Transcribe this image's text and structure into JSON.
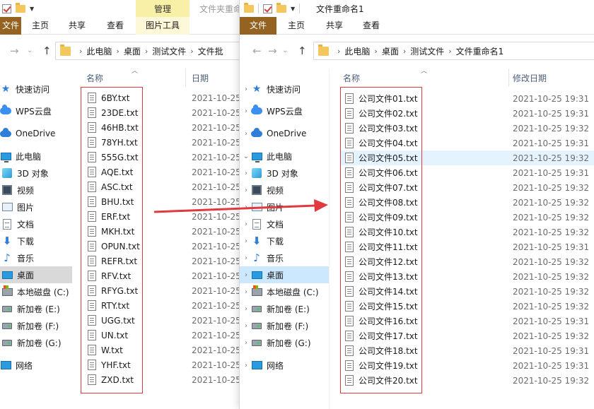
{
  "left": {
    "title": "文件夹重命",
    "context_tab": "管理",
    "ribbon_tabs": [
      "文件",
      "主页",
      "共享",
      "查看",
      "图片工具"
    ],
    "breadcrumb": [
      "此电脑",
      "桌面",
      "测试文件",
      "文件批"
    ],
    "columns": {
      "name": "名称",
      "date": "日期"
    },
    "nav_items": [
      "快速访问",
      "WPS云盘",
      "OneDrive",
      "此电脑",
      "3D 对象",
      "视频",
      "图片",
      "文档",
      "下载",
      "音乐",
      "桌面",
      "本地磁盘 (C:)",
      "新加卷 (E:)",
      "新加卷 (F:)",
      "新加卷 (G:)",
      "网络"
    ],
    "files": [
      "6BY.txt",
      "23DE.txt",
      "46HB.txt",
      "78YH.txt",
      "555G.txt",
      "AQE.txt",
      "ASC.txt",
      "BHU.txt",
      "ERF.txt",
      "MKH.txt",
      "OPUN.txt",
      "REFR.txt",
      "RFV.txt",
      "RFYG.txt",
      "RTY.txt",
      "UGG.txt",
      "UN.txt",
      "W.txt",
      "YHF.txt",
      "ZXD.txt"
    ],
    "date_text": "2021-10-25"
  },
  "right": {
    "title": "文件重命名1",
    "ribbon_tabs": [
      "文件",
      "主页",
      "共享",
      "查看"
    ],
    "breadcrumb": [
      "此电脑",
      "桌面",
      "测试文件",
      "文件重命名1"
    ],
    "columns": {
      "name": "名称",
      "date": "修改日期"
    },
    "nav_items": [
      "快速访问",
      "WPS云盘",
      "OneDrive",
      "此电脑",
      "3D 对象",
      "视频",
      "图片",
      "文档",
      "下载",
      "音乐",
      "桌面",
      "本地磁盘 (C:)",
      "新加卷 (E:)",
      "新加卷 (F:)",
      "新加卷 (G:)",
      "网络"
    ],
    "files": [
      {
        "name": "公司文件01.txt",
        "date": "2021-10-25 19:31"
      },
      {
        "name": "公司文件02.txt",
        "date": "2021-10-25 19:31"
      },
      {
        "name": "公司文件03.txt",
        "date": "2021-10-25 19:32"
      },
      {
        "name": "公司文件04.txt",
        "date": "2021-10-25 19:31"
      },
      {
        "name": "公司文件05.txt",
        "date": "2021-10-25 19:32"
      },
      {
        "name": "公司文件06.txt",
        "date": "2021-10-25 19:31"
      },
      {
        "name": "公司文件07.txt",
        "date": "2021-10-25 19:32"
      },
      {
        "name": "公司文件08.txt",
        "date": "2021-10-25 19:32"
      },
      {
        "name": "公司文件09.txt",
        "date": "2021-10-25 19:32"
      },
      {
        "name": "公司文件10.txt",
        "date": "2021-10-25 19:32"
      },
      {
        "name": "公司文件11.txt",
        "date": "2021-10-25 19:31"
      },
      {
        "name": "公司文件12.txt",
        "date": "2021-10-25 19:32"
      },
      {
        "name": "公司文件13.txt",
        "date": "2021-10-25 19:32"
      },
      {
        "name": "公司文件14.txt",
        "date": "2021-10-25 19:32"
      },
      {
        "name": "公司文件15.txt",
        "date": "2021-10-25 19:32"
      },
      {
        "name": "公司文件16.txt",
        "date": "2021-10-25 19:31"
      },
      {
        "name": "公司文件17.txt",
        "date": "2021-10-25 19:32"
      },
      {
        "name": "公司文件18.txt",
        "date": "2021-10-25 19:31"
      },
      {
        "name": "公司文件19.txt",
        "date": "2021-10-25 19:31"
      },
      {
        "name": "公司文件20.txt",
        "date": "2021-10-25 19:32"
      }
    ]
  },
  "colors": {
    "file_tab": "#946321",
    "selection": "#cce8ff",
    "annotation_red": "#e0393e"
  }
}
